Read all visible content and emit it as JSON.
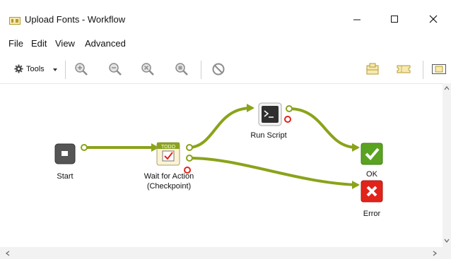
{
  "window": {
    "title": "Upload Fonts - Workflow",
    "app_icon": "workflow-icon",
    "controls": [
      "minimize-icon",
      "maximize-icon",
      "close-icon"
    ]
  },
  "menu": {
    "items": [
      {
        "label": "File"
      },
      {
        "label": "Edit"
      },
      {
        "label": "View"
      },
      {
        "label": "Advanced"
      }
    ]
  },
  "toolbar": {
    "tools_label": "Tools",
    "icons": [
      "zoom-in-icon",
      "zoom-out-icon",
      "zoom-reset-icon",
      "zoom-fit-icon",
      "stop-icon",
      "layout-icon",
      "ticket-icon",
      "panel-icon"
    ]
  },
  "workflow": {
    "colors": {
      "connector": "#8aa31a",
      "start": "#555555",
      "ok": "#5aa321",
      "error": "#e2231a",
      "error_dot": "#e2231a"
    },
    "nodes": {
      "start": {
        "label": "Start"
      },
      "checkpoint": {
        "label_line1": "Wait for Action",
        "label_line2": "(Checkpoint)",
        "badge": "TODO"
      },
      "run_script": {
        "label": "Run Script"
      },
      "ok": {
        "label": "OK"
      },
      "error": {
        "label": "Error"
      }
    }
  }
}
